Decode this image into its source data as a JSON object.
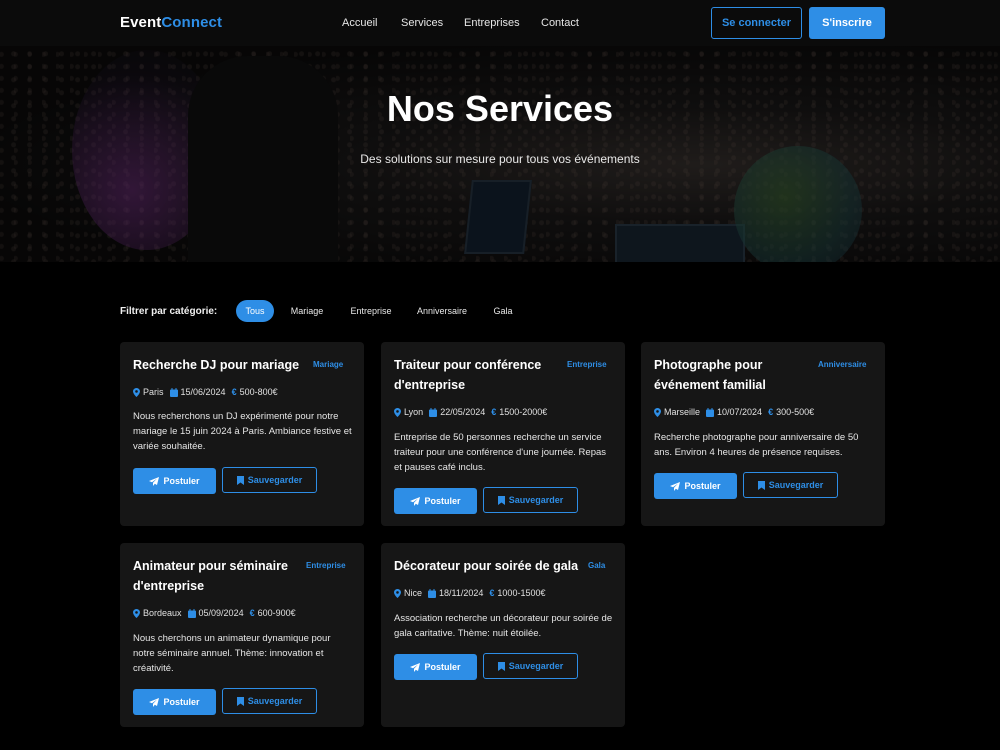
{
  "brand": {
    "part1": "Event",
    "part2": "Connect"
  },
  "nav": {
    "links": [
      "Accueil",
      "Services",
      "Entreprises",
      "Contact"
    ],
    "login": "Se connecter",
    "signup": "S'inscrire"
  },
  "hero": {
    "title": "Nos Services",
    "subtitle": "Des solutions sur mesure pour tous vos événements"
  },
  "filters": {
    "label": "Filtrer par catégorie:",
    "chips": [
      "Tous",
      "Mariage",
      "Entreprise",
      "Anniversaire",
      "Gala"
    ],
    "active": "Tous"
  },
  "colors": {
    "accent": "#2e8ee6",
    "card_bg": "#161616",
    "page_bg": "#000000"
  },
  "buttons": {
    "apply": "Postuler",
    "save": "Sauvegarder"
  },
  "cards": [
    {
      "title": "Recherche DJ pour mariage",
      "category": "Mariage",
      "location": "Paris",
      "date": "15/06/2024",
      "budget": "500-800€",
      "description": "Nous recherchons un DJ expérimenté pour notre mariage le 15 juin 2024 à Paris. Ambiance festive et variée souhaitée."
    },
    {
      "title": "Traiteur pour conférence d'entreprise",
      "category": "Entreprise",
      "location": "Lyon",
      "date": "22/05/2024",
      "budget": "1500-2000€",
      "description": "Entreprise de 50 personnes recherche un service traiteur pour une conférence d'une journée. Repas et pauses café inclus."
    },
    {
      "title": "Photographe pour événement familial",
      "category": "Anniversaire",
      "location": "Marseille",
      "date": "10/07/2024",
      "budget": "300-500€",
      "description": "Recherche photographe pour anniversaire de 50 ans. Environ 4 heures de présence requises."
    },
    {
      "title": "Animateur pour séminaire d'entreprise",
      "category": "Entreprise",
      "location": "Bordeaux",
      "date": "05/09/2024",
      "budget": "600-900€",
      "description": "Nous cherchons un animateur dynamique pour notre séminaire annuel. Thème: innovation et créativité."
    },
    {
      "title": "Décorateur pour soirée de gala",
      "category": "Gala",
      "location": "Nice",
      "date": "18/11/2024",
      "budget": "1000-1500€",
      "description": "Association recherche un décorateur pour soirée de gala caritative. Thème: nuit étoilée."
    }
  ],
  "icons": {
    "location": "map-pin-icon",
    "date": "calendar-icon",
    "budget": "euro-icon",
    "apply": "paper-plane-icon",
    "save": "bookmark-icon"
  }
}
